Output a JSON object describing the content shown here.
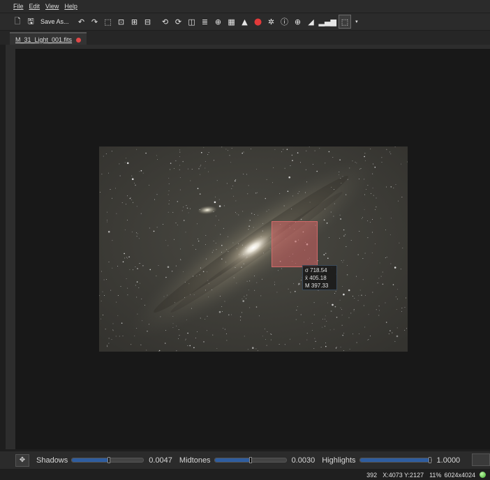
{
  "menu": [
    "File",
    "Edit",
    "View",
    "Help"
  ],
  "toolbar": {
    "save_as_label": "Save As...",
    "icons": [
      "new-icon",
      "save-icon",
      "undo-icon",
      "redo-icon",
      "fit-icon",
      "zoom-selection-icon",
      "zoom-in-icon",
      "zoom-out-icon",
      "flip-h-icon",
      "flip-v-icon",
      "split-icon",
      "balance-icon",
      "crosshair-icon",
      "grid-icon",
      "stretch-icon",
      "record-icon",
      "stars-icon",
      "info-icon",
      "target-icon",
      "histogram-icon",
      "signal-icon",
      "selection-icon"
    ]
  },
  "tab": {
    "title": "M_31_Light_001.fits"
  },
  "overlay_stats": {
    "sigma": "σ 718.54",
    "mean": "x̄ 405.18",
    "median": "M 397.33"
  },
  "stretch": {
    "shadows_label": "Shadows",
    "shadows_value": "0.0047",
    "shadows_pos": 0.52,
    "midtones_label": "Midtones",
    "midtones_value": "0.0030",
    "midtones_pos": 0.5,
    "highlights_label": "Highlights",
    "highlights_value": "1.0000",
    "highlights_pos": 1.0
  },
  "status": {
    "value": "392",
    "coords": "X:4073 Y:2127",
    "zoom": "11%",
    "size": "6024x4024"
  },
  "colors": {
    "accent": "#2e5da0",
    "roi": "#d26464",
    "tab_close": "#e04848",
    "status_ok": "#3bb12a"
  }
}
